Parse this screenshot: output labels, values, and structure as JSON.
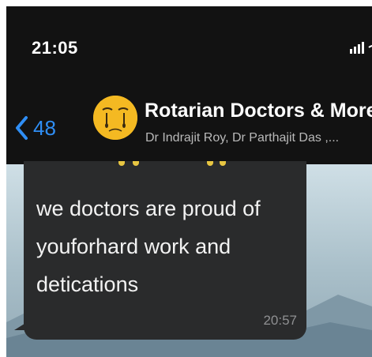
{
  "status_bar": {
    "time": "21:05",
    "icons": [
      "signal-icon",
      "wifi-icon"
    ]
  },
  "header": {
    "back_icon": "chevron-left-icon",
    "back_count": "48",
    "avatar_icon": "crying-emoji-avatar",
    "title": "Rotarian Doctors & More",
    "subtitle": "Dr Indrajit Roy, Dr Parthajit Das ,..."
  },
  "message": {
    "text": "we doctors are proud of\nyouforhard work and\ndetications",
    "time": "20:57"
  },
  "colors": {
    "header_bg": "#121212",
    "accent_blue": "#2f8ef5",
    "bubble_bg": "#2a2b2c",
    "avatar_yellow": "#f4b922"
  }
}
